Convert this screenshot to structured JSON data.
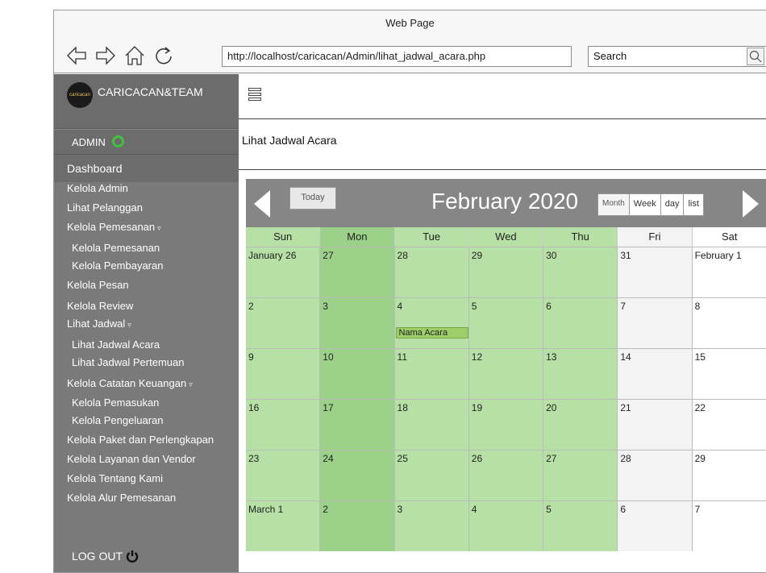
{
  "browser": {
    "title": "Web Page",
    "url": "http://localhost/caricacan/Admin/lihat_jadwal_acara.php",
    "search_label": "Search"
  },
  "sidebar": {
    "brand_logo_text": "caricacan",
    "brand_name": "CARICACAN&TEAM",
    "admin_label": "ADMIN",
    "dashboard_label": "Dashboard",
    "items": [
      {
        "label": "Kelola Admin",
        "level": 0
      },
      {
        "label": "Lihat Pelanggan",
        "level": 0
      },
      {
        "label": "Kelola Pemesanan",
        "level": 0,
        "has_caret": true
      },
      {
        "label": "Kelola Pemesanan",
        "level": 1
      },
      {
        "label": "Kelola Pembayaran",
        "level": 1
      },
      {
        "label": "Kelola Pesan",
        "level": 0
      },
      {
        "label": "Kelola Review",
        "level": 0
      },
      {
        "label": "Lihat Jadwal",
        "level": 0,
        "has_caret": true
      },
      {
        "label": "Lihat Jadwal Acara",
        "level": 1
      },
      {
        "label": "Lihat Jadwal Pertemuan",
        "level": 1
      },
      {
        "label": "Kelola Catatan Keuangan",
        "level": 0,
        "has_caret": true
      },
      {
        "label": "Kelola Pemasukan",
        "level": 1
      },
      {
        "label": "Kelola Pengeluaran",
        "level": 1
      },
      {
        "label": "Kelola Paket dan Perlengkapan",
        "level": 0
      },
      {
        "label": "Kelola Layanan dan Vendor",
        "level": 0
      },
      {
        "label": "Kelola Tentang Kami",
        "level": 0
      },
      {
        "label": "Kelola Alur Pemesanan",
        "level": 0
      }
    ],
    "logout_label": "LOG OUT"
  },
  "page": {
    "title": "Lihat Jadwal Acara"
  },
  "calendar": {
    "today_label": "Today",
    "month_title": "February 2020",
    "views": [
      "Month",
      "Week",
      "day",
      "list"
    ],
    "weekdays": [
      "Sun",
      "Mon",
      "Tue",
      "Wed",
      "Thu",
      "Fri",
      "Sat"
    ],
    "weeks": [
      [
        "January 26",
        "27",
        "28",
        "29",
        "30",
        "31",
        "February 1"
      ],
      [
        "2",
        "3",
        "4",
        "5",
        "6",
        "7",
        "8"
      ],
      [
        "9",
        "10",
        "11",
        "12",
        "13",
        "14",
        "15"
      ],
      [
        "16",
        "17",
        "18",
        "19",
        "20",
        "21",
        "22"
      ],
      [
        "23",
        "24",
        "25",
        "26",
        "27",
        "28",
        "29"
      ],
      [
        "March 1",
        "2",
        "3",
        "4",
        "5",
        "6",
        "7"
      ]
    ],
    "events": [
      {
        "title": "Nama Acara",
        "week": 1,
        "day": 2
      }
    ],
    "column_tints": [
      "green-light",
      "green",
      "green-light",
      "green-light",
      "green-light",
      "gray",
      "white"
    ]
  },
  "colors": {
    "sidebar_bg": "#7a7a7a",
    "status_online": "#3fc33f",
    "event_bg": "#9ccf6a",
    "header_bg": "#868686"
  }
}
